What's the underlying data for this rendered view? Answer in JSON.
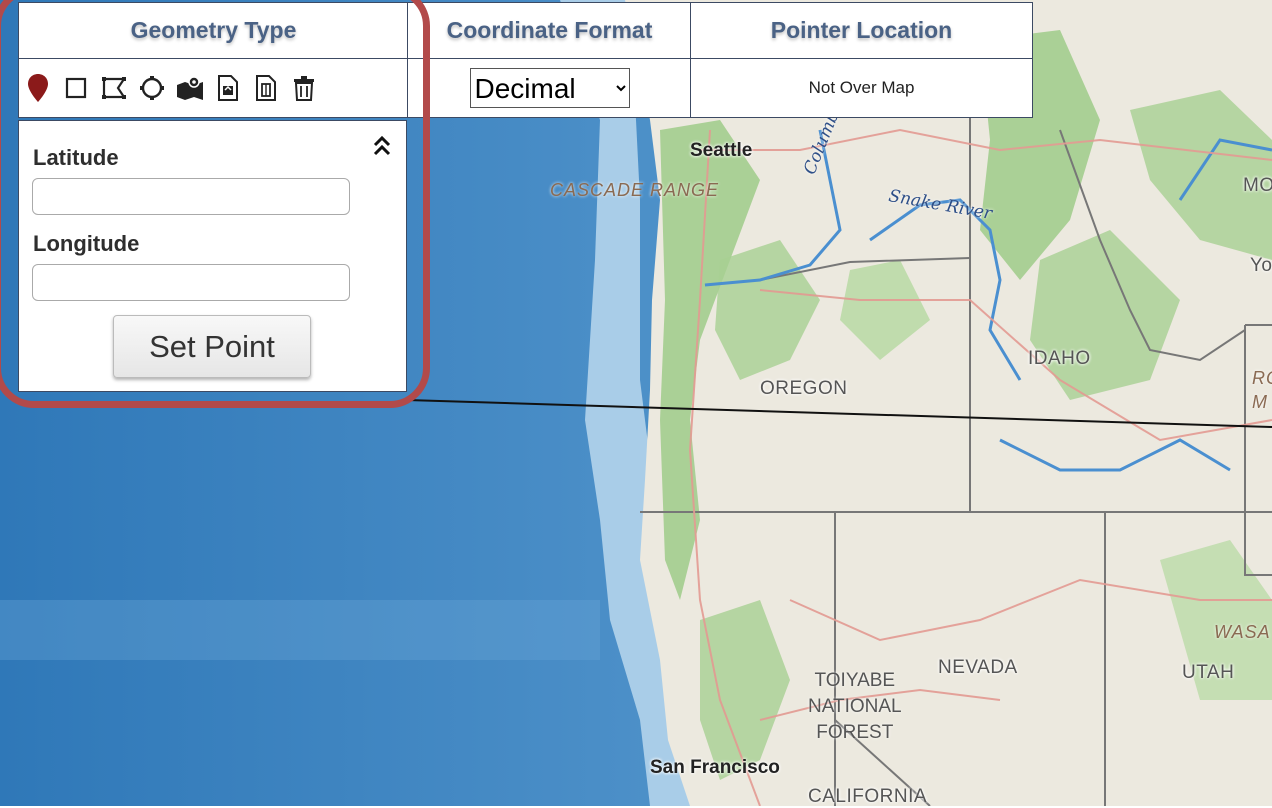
{
  "toolbar": {
    "geometry_type_label": "Geometry Type",
    "coordinate_format_label": "Coordinate Format",
    "pointer_location_label": "Pointer Location",
    "geometry_tools": [
      {
        "name": "point-marker-icon"
      },
      {
        "name": "rectangle-icon"
      },
      {
        "name": "polygon-icon"
      },
      {
        "name": "circle-icon"
      },
      {
        "name": "map-area-icon"
      },
      {
        "name": "import-file-icon"
      },
      {
        "name": "export-file-icon"
      },
      {
        "name": "trash-icon"
      }
    ],
    "coordinate_format": {
      "selected": "Decimal",
      "options": [
        "Decimal"
      ]
    },
    "pointer_location": "Not Over Map"
  },
  "panel": {
    "latitude_label": "Latitude",
    "latitude_value": "",
    "longitude_label": "Longitude",
    "longitude_value": "",
    "set_point_label": "Set Point"
  },
  "map": {
    "labels": {
      "seattle": "Seattle",
      "cascade_range": "CASCADE RANGE",
      "columbia": "Columbia",
      "snake_river": "Snake River",
      "mo": "MO",
      "yo": "Yo",
      "idaho": "IDAHO",
      "oregon": "OREGON",
      "ro": "RO",
      "m": "M",
      "wasa": "WASA",
      "nevada": "NEVADA",
      "utah": "UTAH",
      "toiyabe_forest": [
        "TOIYABE",
        "NATIONAL",
        "FOREST"
      ],
      "san_francisco": "San Francisco",
      "california": "CALIFORNIA"
    }
  },
  "colors": {
    "header_text": "#4a6285",
    "border": "#3c4a63",
    "highlight": "#b24a4a",
    "marker": "#8b1a1a",
    "ocean": "#3f86c2",
    "land": "#e9e6dc"
  }
}
